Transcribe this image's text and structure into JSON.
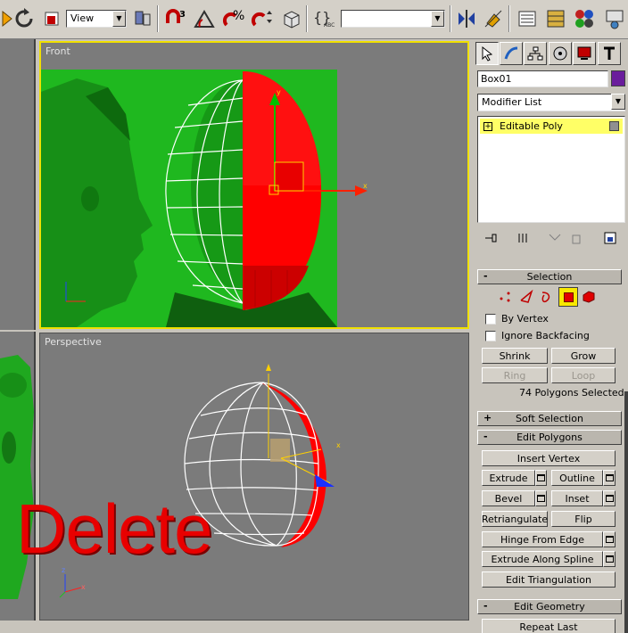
{
  "toolbar": {
    "view_combo": "View",
    "named_selection_combo": "",
    "icons": [
      "select-icon",
      "rotate-icon",
      "scale-icon",
      "selection-filter-icon",
      "angle-snap-icon",
      "snap-3-icon",
      "percent-snap-icon",
      "spinner-snap-icon",
      "named-selection-icon",
      "mirror-icon",
      "align-icon",
      "layer-manager-icon",
      "curve-editor-icon",
      "material-editor-icon",
      "render-icon"
    ],
    "snap_label": "3"
  },
  "viewports": {
    "front": {
      "label": "Front"
    },
    "perspective": {
      "label": "Perspective"
    }
  },
  "overlay_text": "Delete",
  "command_panel": {
    "object_name": "Box01",
    "object_color": "#6a1d9c",
    "modifier_list": "Modifier List",
    "stack_items": [
      {
        "label": "Editable Poly",
        "sign": "+"
      }
    ],
    "rollouts": {
      "selection": {
        "title": "Selection",
        "sign": "-",
        "by_vertex": "By Vertex",
        "ignore_backfacing": "Ignore Backfacing",
        "shrink": "Shrink",
        "grow": "Grow",
        "ring": "Ring",
        "loop": "Loop",
        "status": "74 Polygons Selected"
      },
      "soft_selection": {
        "title": "Soft Selection",
        "sign": "+"
      },
      "edit_polygons": {
        "title": "Edit Polygons",
        "sign": "-",
        "insert_vertex": "Insert Vertex",
        "extrude": "Extrude",
        "outline": "Outline",
        "bevel": "Bevel",
        "inset": "Inset",
        "retriangulate": "Retriangulate",
        "flip": "Flip",
        "hinge_from_edge": "Hinge From Edge",
        "extrude_along_spline": "Extrude Along Spline",
        "edit_triangulation": "Edit Triangulation"
      },
      "edit_geometry": {
        "title": "Edit Geometry",
        "sign": "-",
        "repeat_last": "Repeat Last"
      }
    }
  },
  "colors": {
    "accent_yellow": "#ffff00",
    "viewport_bg": "#7b7b7b",
    "face_green": "#1fb81f",
    "selection_red": "#ff0000"
  }
}
